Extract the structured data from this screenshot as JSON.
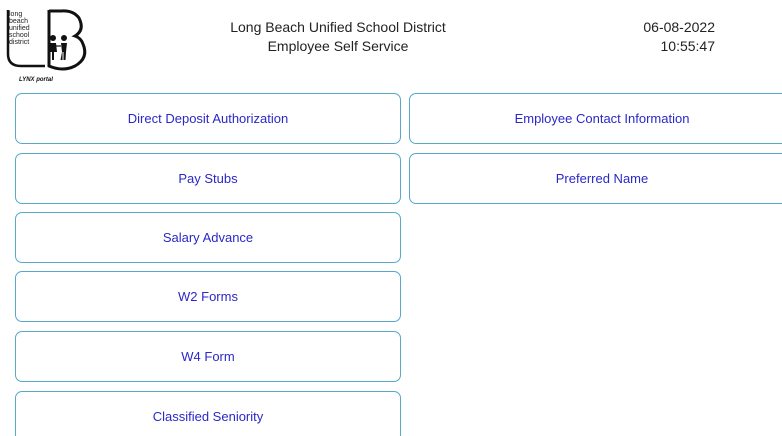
{
  "logo": {
    "text_lines": "long\nbeach\nunified\nschool\ndistrict",
    "portal_label": "LYNX portal"
  },
  "header": {
    "line1": "Long Beach Unified School District",
    "line2": "Employee Self Service"
  },
  "datetime": {
    "date": "06-08-2022",
    "time": "10:55:47"
  },
  "menu": {
    "left": [
      "Direct Deposit Authorization",
      "Pay Stubs",
      "Salary Advance",
      "W2 Forms",
      "W4 Form",
      "Classified Seniority"
    ],
    "right": [
      "Employee Contact Information",
      "Preferred Name"
    ]
  },
  "colors": {
    "button_border": "#59a7c9",
    "button_text": "#2b28c8"
  }
}
